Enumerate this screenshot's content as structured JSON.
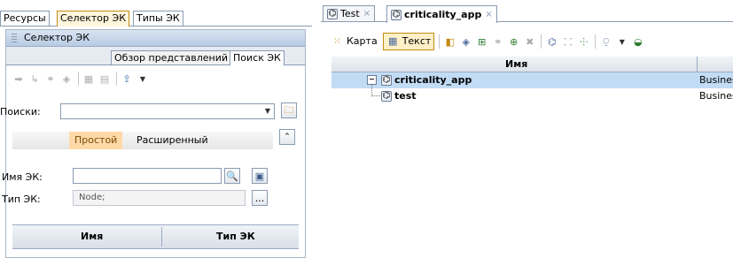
{
  "left": {
    "tabs": [
      "Ресурсы",
      "Селектор ЭК",
      "Типы ЭК"
    ],
    "panel_title": "Селектор ЭК",
    "subtabs": [
      "Обзор представлений",
      "Поиск ЭК"
    ],
    "search_label": "Поиски:",
    "search_value": "",
    "modes": [
      "Простой",
      "Расширенный"
    ],
    "name_label": "Имя ЭК:",
    "name_value": "",
    "type_label": "Тип ЭК:",
    "type_value": "Node;",
    "more_button": "...",
    "columns": [
      "Имя",
      "Тип ЭК"
    ]
  },
  "right": {
    "tabs": [
      {
        "label": "Test",
        "close": "×"
      },
      {
        "label": "criticality_app",
        "close": "×"
      }
    ],
    "toolbar": {
      "map": "Карта",
      "text": "Текст"
    },
    "grid_header": "Имя",
    "rows": [
      {
        "expander": "−",
        "name": "criticality_app",
        "type": "Busines"
      },
      {
        "expander": "",
        "name": "test",
        "type": "Busines"
      }
    ]
  },
  "colors": {
    "accent": "#c48a10",
    "selection": "#c2dcf5",
    "mode_active": "#ffd9a8"
  }
}
